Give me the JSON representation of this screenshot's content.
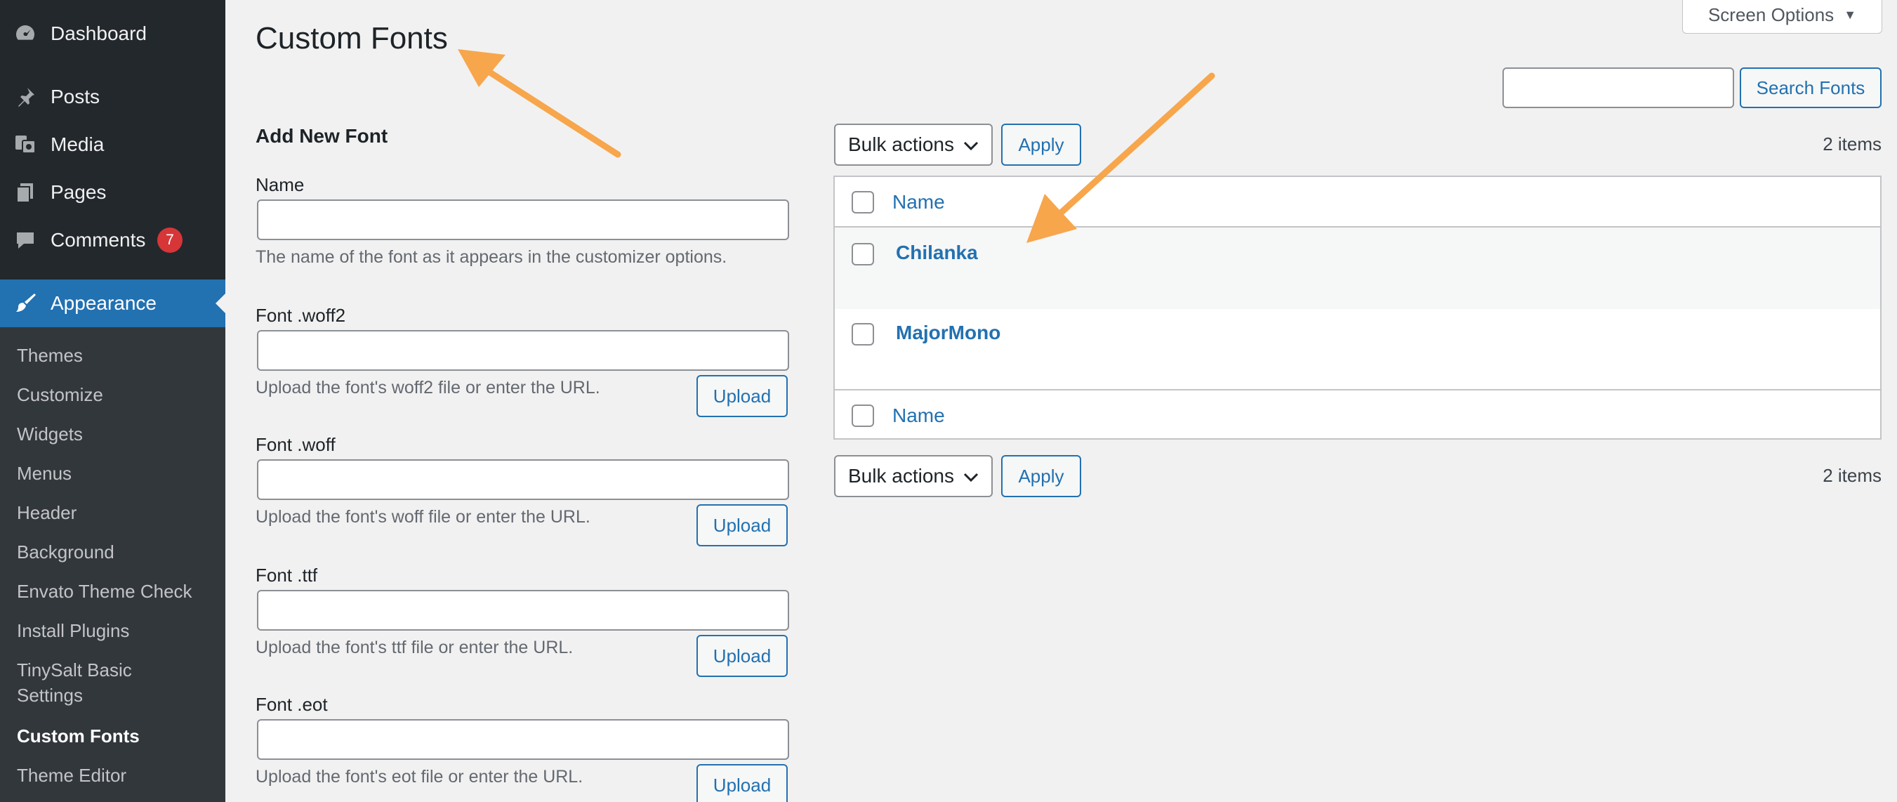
{
  "sidebar": {
    "menu": [
      {
        "label": "Dashboard",
        "icon": "dashboard-icon"
      },
      {
        "label": "Posts",
        "icon": "pin-icon"
      },
      {
        "label": "Media",
        "icon": "media-icon"
      },
      {
        "label": "Pages",
        "icon": "pages-icon"
      },
      {
        "label": "Comments",
        "icon": "comment-icon",
        "badge": "7"
      },
      {
        "label": "Appearance",
        "icon": "paintbrush-icon"
      }
    ],
    "submenu": [
      "Themes",
      "Customize",
      "Widgets",
      "Menus",
      "Header",
      "Background",
      "Envato Theme Check",
      "Install Plugins",
      "TinySalt Basic Settings",
      "Custom Fonts",
      "Theme Editor"
    ]
  },
  "page": {
    "title": "Custom Fonts",
    "screen_options": "Screen Options"
  },
  "form": {
    "heading": "Add New Font",
    "fields": [
      {
        "label": "Name",
        "desc": "The name of the font as it appears in the customizer options."
      },
      {
        "label": "Font .woff2",
        "desc": "Upload the font's woff2 file or enter the URL.",
        "button": "Upload"
      },
      {
        "label": "Font .woff",
        "desc": "Upload the font's woff file or enter the URL.",
        "button": "Upload"
      },
      {
        "label": "Font .ttf",
        "desc": "Upload the font's ttf file or enter the URL.",
        "button": "Upload"
      },
      {
        "label": "Font .eot",
        "desc": "Upload the font's eot file or enter the URL.",
        "button": "Upload"
      }
    ]
  },
  "list": {
    "search_button": "Search Fonts",
    "bulk_actions": "Bulk actions",
    "apply": "Apply",
    "count": "2 items",
    "column_name": "Name",
    "rows": [
      "Chilanka",
      "MajorMono"
    ]
  },
  "colors": {
    "sidebar_bg": "#23282d",
    "accent": "#2271b1",
    "badge": "#d63638",
    "annotation_arrow": "#f7a64c"
  }
}
